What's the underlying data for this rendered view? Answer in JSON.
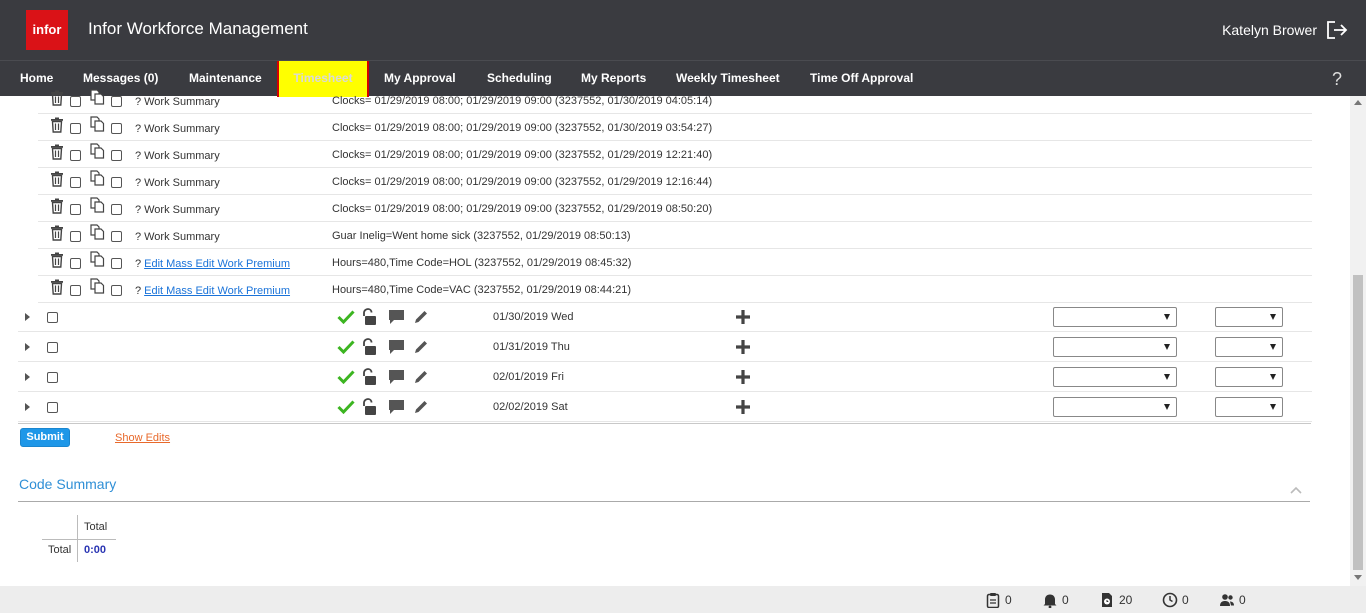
{
  "header": {
    "logo_text": "infor",
    "app_title": "Infor Workforce Management",
    "user_name": "Katelyn Brower"
  },
  "nav": {
    "items": [
      {
        "label": "Home"
      },
      {
        "label": "Messages (0)"
      },
      {
        "label": "Maintenance"
      },
      {
        "label": "Timesheet",
        "active": true
      },
      {
        "label": "My Approval"
      },
      {
        "label": "Scheduling"
      },
      {
        "label": "My Reports"
      },
      {
        "label": "Weekly Timesheet"
      },
      {
        "label": "Time Off Approval"
      }
    ],
    "help_label": "?"
  },
  "detail_rows": [
    {
      "q": "?",
      "label": "Work Summary",
      "link": false,
      "desc": "Clocks= 01/29/2019 08:00; 01/29/2019 09:00 (3237552, 01/30/2019 04:05:14)"
    },
    {
      "q": "?",
      "label": "Work Summary",
      "link": false,
      "desc": "Clocks= 01/29/2019 08:00; 01/29/2019 09:00 (3237552, 01/30/2019 03:54:27)"
    },
    {
      "q": "?",
      "label": "Work Summary",
      "link": false,
      "desc": "Clocks= 01/29/2019 08:00; 01/29/2019 09:00 (3237552, 01/29/2019 12:21:40)"
    },
    {
      "q": "?",
      "label": "Work Summary",
      "link": false,
      "desc": "Clocks= 01/29/2019 08:00; 01/29/2019 09:00 (3237552, 01/29/2019 12:16:44)"
    },
    {
      "q": "?",
      "label": "Work Summary",
      "link": false,
      "desc": "Clocks= 01/29/2019 08:00; 01/29/2019 09:00 (3237552, 01/29/2019 08:50:20)"
    },
    {
      "q": "?",
      "label": "Work Summary",
      "link": false,
      "desc": "Guar Inelig=Went home sick (3237552, 01/29/2019 08:50:13)"
    },
    {
      "q": "?",
      "label": "Edit Mass Edit Work Premium",
      "link": true,
      "desc": "Hours=480,Time Code=HOL (3237552, 01/29/2019 08:45:32)"
    },
    {
      "q": "?",
      "label": "Edit Mass Edit Work Premium",
      "link": true,
      "desc": "Hours=480,Time Code=VAC (3237552, 01/29/2019 08:44:21)"
    }
  ],
  "day_rows": [
    {
      "date": "01/30/2019 Wed"
    },
    {
      "date": "01/31/2019 Thu"
    },
    {
      "date": "02/01/2019 Fri"
    },
    {
      "date": "02/02/2019 Sat"
    }
  ],
  "actions": {
    "submit_label": "Submit",
    "show_edits_label": "Show Edits"
  },
  "code_summary": {
    "title": "Code Summary",
    "column_header": "Total",
    "row_label": "Total",
    "value": "0:00"
  },
  "footer": {
    "stats": [
      {
        "icon": "clipboard-icon",
        "value": "0"
      },
      {
        "icon": "bell-icon",
        "value": "0"
      },
      {
        "icon": "document-clock-icon",
        "value": "20"
      },
      {
        "icon": "clock-icon",
        "value": "0"
      },
      {
        "icon": "people-icon",
        "value": "0"
      }
    ]
  },
  "colors": {
    "header_bg": "#3a3b40",
    "active_tab_bg": "#ffff00",
    "link": "#1a73d9",
    "accent": "#1e97e8",
    "check": "#3cb521"
  }
}
